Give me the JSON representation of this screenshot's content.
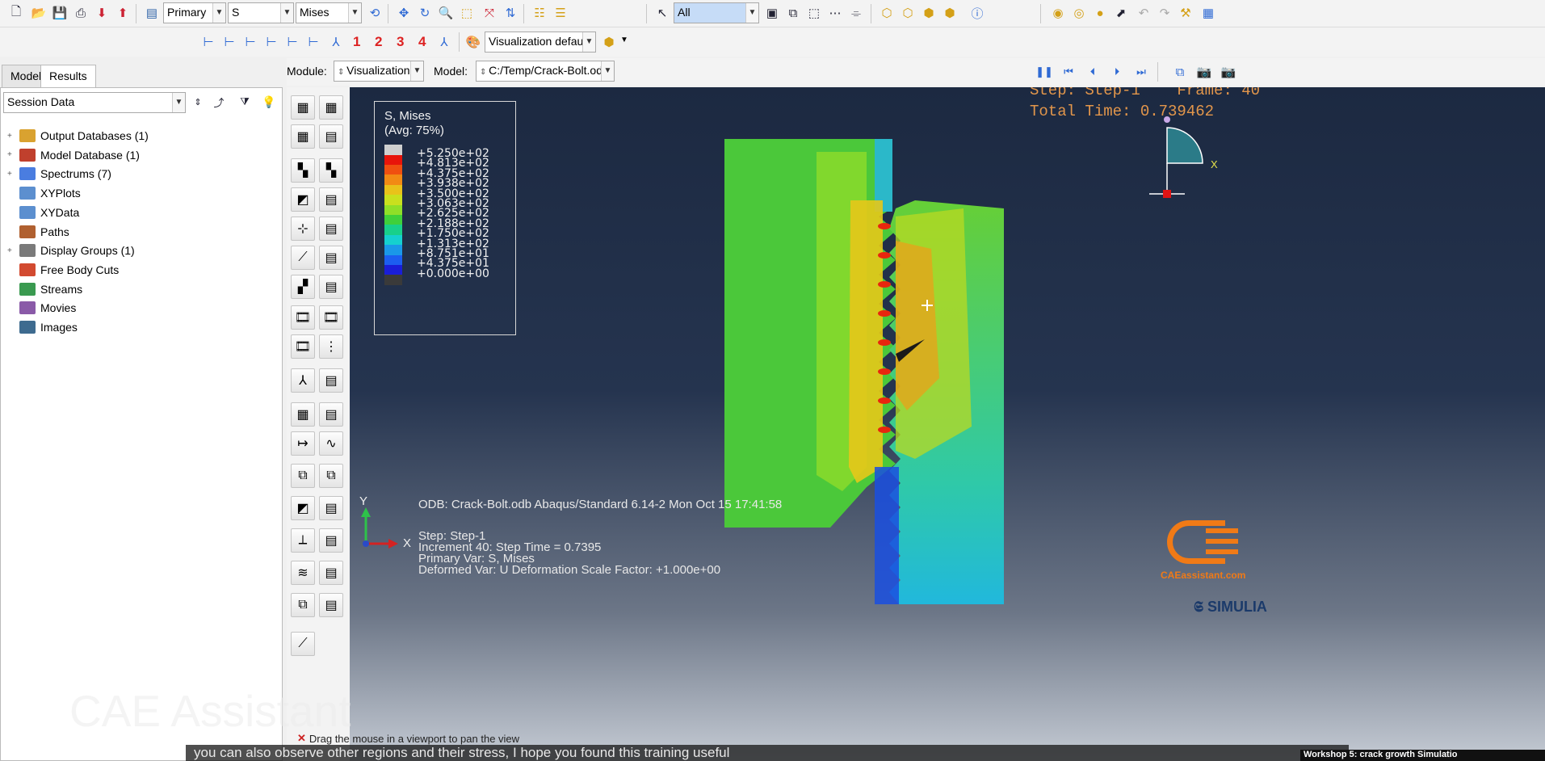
{
  "toolbar1": {
    "primary": "Primary",
    "variable": "S",
    "invariant": "Mises",
    "selection": "All"
  },
  "toolbar2": {
    "numbers": [
      "1",
      "2",
      "3",
      "4"
    ],
    "viz_defaults": "Visualization defaults"
  },
  "module_bar": {
    "module_label": "Module:",
    "module_value": "Visualization",
    "model_label": "Model:",
    "model_value": "C:/Temp/Crack-Bolt.odb"
  },
  "left_tabs": [
    "Model",
    "Results"
  ],
  "session_data": "Session Data",
  "tree": [
    {
      "label": "Output Databases (1)",
      "expand": "+",
      "color": "#d9a230"
    },
    {
      "label": "Model Database (1)",
      "expand": "+",
      "color": "#c0402d"
    },
    {
      "label": "Spectrums (7)",
      "expand": "+",
      "color": "#4a7de0"
    },
    {
      "label": "XYPlots",
      "expand": "",
      "color": "#5c8fcf"
    },
    {
      "label": "XYData",
      "expand": "",
      "color": "#5c8fcf"
    },
    {
      "label": "Paths",
      "expand": "",
      "color": "#b06030"
    },
    {
      "label": "Display Groups (1)",
      "expand": "+",
      "color": "#7a7a7a"
    },
    {
      "label": "Free Body Cuts",
      "expand": "",
      "color": "#d24a30"
    },
    {
      "label": "Streams",
      "expand": "",
      "color": "#3a9a50"
    },
    {
      "label": "Movies",
      "expand": "",
      "color": "#8a5aa8"
    },
    {
      "label": "Images",
      "expand": "",
      "color": "#3e6b8f"
    }
  ],
  "legend": {
    "title": "S, Mises",
    "subtitle": "(Avg: 75%)",
    "values": [
      "+5.250e+02",
      "+4.813e+02",
      "+4.375e+02",
      "+3.938e+02",
      "+3.500e+02",
      "+3.063e+02",
      "+2.625e+02",
      "+2.188e+02",
      "+1.750e+02",
      "+1.313e+02",
      "+8.751e+01",
      "+4.375e+01",
      "+0.000e+00"
    ],
    "colors": [
      "#cfcfcf",
      "#e8140a",
      "#f04f10",
      "#f28a14",
      "#e9c21a",
      "#c9e01e",
      "#8fdf28",
      "#3fd03a",
      "#18d08a",
      "#15d0cf",
      "#1a98e8",
      "#1c5ef0",
      "#1a1ed8",
      "#3a3a3a"
    ]
  },
  "step_info": {
    "line1": "Step: Step-1    Frame: 40",
    "line2": "Total Time: 0.739462"
  },
  "triad": {
    "x": "X",
    "y": "Y"
  },
  "odb_info": {
    "line1": "ODB: Crack-Bolt.odb    Abaqus/Standard 6.14-2    Mon Oct 15 17:41:58",
    "step": "Step: Step-1",
    "increment": "Increment     40: Step Time =     0.7395",
    "primary": "Primary Var: S, Mises",
    "deformed": "Deformed Var: U    Deformation Scale Factor: +1.000e+00"
  },
  "status_prompt": "Drag the mouse in a viewport to pan the view",
  "watermark": "CAE Assistant",
  "logo_url": "CAEassistant.com",
  "simulia": "SIMULIA",
  "subtitle_caption": "you can also observe other regions and their stress, I hope you found this training useful",
  "corner_title": "Workshop 5: crack growth Simulatio"
}
